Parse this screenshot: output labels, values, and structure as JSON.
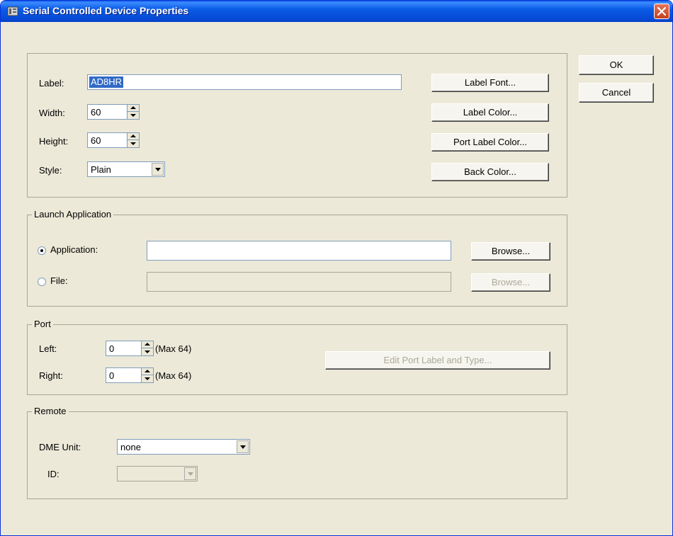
{
  "window": {
    "title": "Serial Controlled Device Properties"
  },
  "dialog_buttons": {
    "ok": "OK",
    "cancel": "Cancel"
  },
  "appearance": {
    "label_caption": "Label:",
    "label_value": "AD8HR",
    "width_caption": "Width:",
    "width_value": "60",
    "height_caption": "Height:",
    "height_value": "60",
    "style_caption": "Style:",
    "style_value": "Plain",
    "label_font_button": "Label Font...",
    "label_color_button": "Label Color...",
    "port_label_color_button": "Port Label Color...",
    "back_color_button": "Back Color..."
  },
  "launch": {
    "legend": "Launch Application",
    "application_option": "Application:",
    "application_value": "",
    "file_option": "File:",
    "file_value": "",
    "browse_label": "Browse...",
    "selected": "application"
  },
  "port": {
    "legend": "Port",
    "left_caption": "Left:",
    "left_value": "0",
    "left_max": "(Max 64)",
    "right_caption": "Right:",
    "right_value": "0",
    "right_max": "(Max 64)",
    "edit_button": "Edit Port Label and Type..."
  },
  "remote": {
    "legend": "Remote",
    "dme_unit_caption": "DME Unit:",
    "dme_unit_value": "none",
    "id_caption": "ID:",
    "id_value": ""
  }
}
